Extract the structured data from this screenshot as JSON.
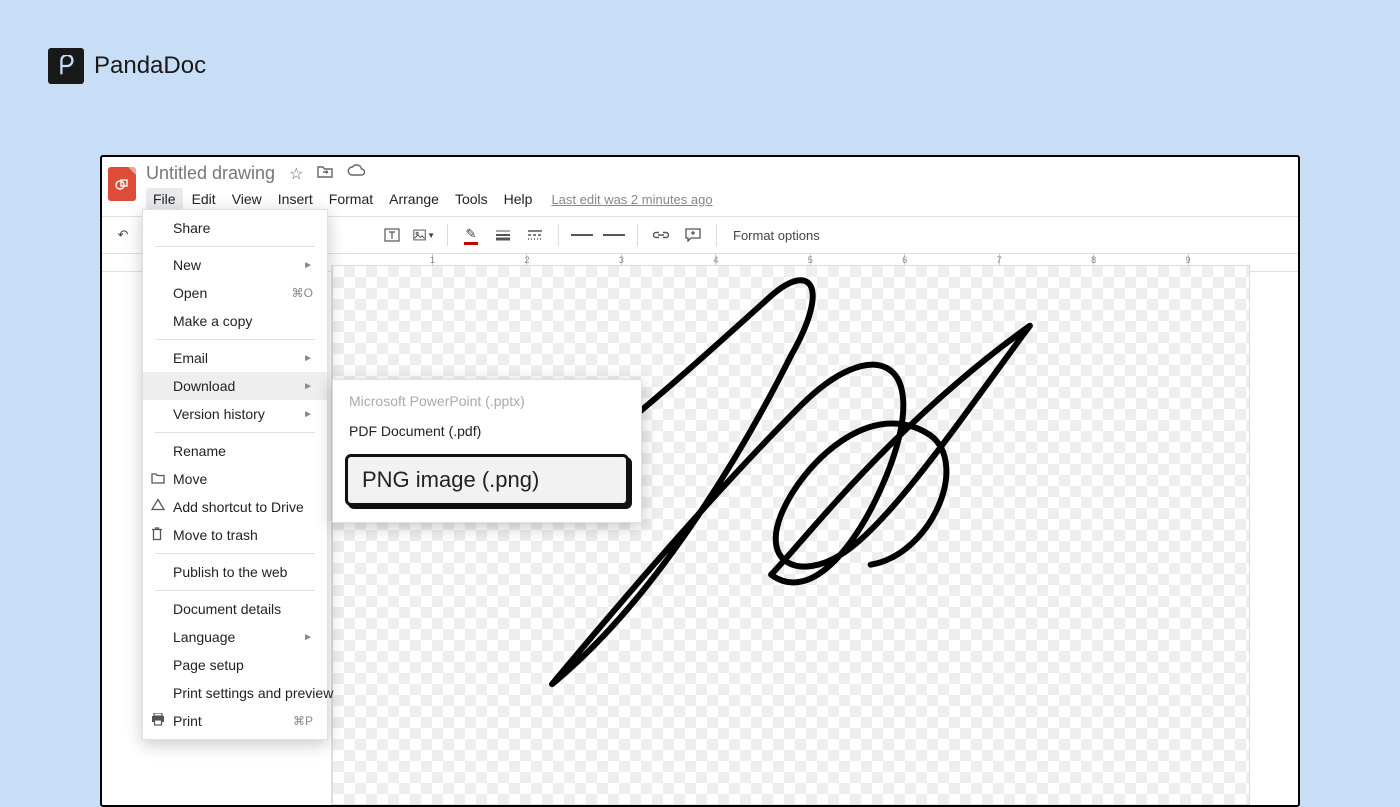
{
  "brand": {
    "name": "PandaDoc",
    "logo_glyph": "p"
  },
  "doc": {
    "title": "Untitled drawing",
    "last_edit": "Last edit was 2 minutes ago"
  },
  "menubar": {
    "items": [
      "File",
      "Edit",
      "View",
      "Insert",
      "Format",
      "Arrange",
      "Tools",
      "Help"
    ],
    "active_index": 0
  },
  "toolbar": {
    "format_options": "Format options"
  },
  "ruler": {
    "marks": [
      1,
      2,
      3,
      4,
      5,
      6,
      7,
      8,
      9
    ]
  },
  "file_menu": {
    "share": "Share",
    "new": "New",
    "open": "Open",
    "open_shortcut": "⌘O",
    "make_copy": "Make a copy",
    "email": "Email",
    "download": "Download",
    "version_history": "Version history",
    "rename": "Rename",
    "move": "Move",
    "add_shortcut": "Add shortcut to Drive",
    "move_trash": "Move to trash",
    "publish_web": "Publish to the web",
    "doc_details": "Document details",
    "language": "Language",
    "page_setup": "Page setup",
    "print_settings": "Print settings and preview",
    "print": "Print",
    "print_shortcut": "⌘P"
  },
  "download_submenu": {
    "pptx": "Microsoft PowerPoint (.pptx)",
    "pdf": "PDF Document (.pdf)",
    "png": "PNG image (.png)"
  }
}
